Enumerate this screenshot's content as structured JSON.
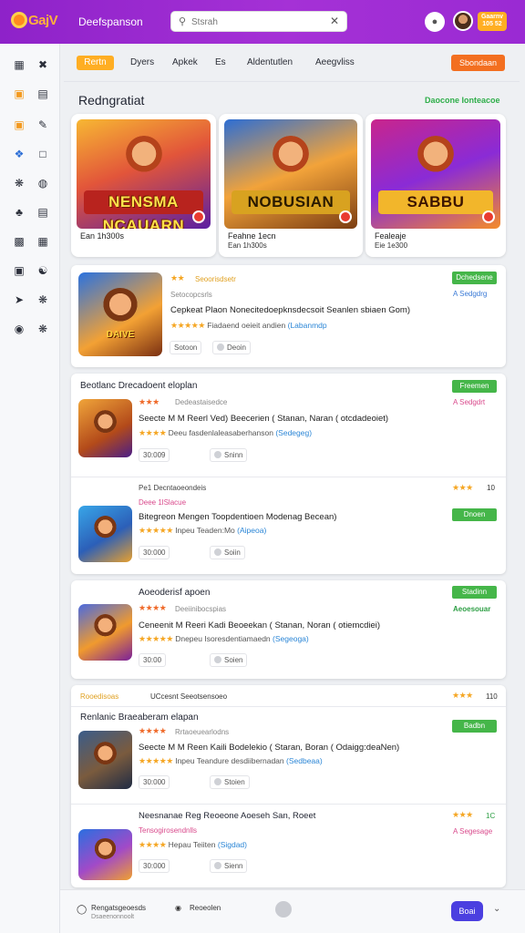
{
  "header": {
    "logo_text": "GajV",
    "app_title": "Deefspanson",
    "search_placeholder": "Stsrah",
    "coins_label": "Gaarnv 105 52"
  },
  "sidebar": {
    "icons": [
      "grid-icon",
      "tools-icon",
      "gamepad-icon",
      "card-icon",
      "tag-icon",
      "edit-icon",
      "puzzle-icon",
      "chat-icon",
      "target-icon",
      "globe-icon",
      "team-icon",
      "document-icon",
      "video-icon",
      "calendar-icon",
      "trophy-icon",
      "users-icon",
      "rocket-icon",
      "settings-icon",
      "discord-icon",
      "apps-icon"
    ]
  },
  "tabs": {
    "items": [
      "Rertn",
      "Dyers",
      "Apkek",
      "Es",
      "Aldentutlen",
      "Aeegvliss"
    ],
    "active_index": 0,
    "subscribe_label": "Sbondaan"
  },
  "featured": {
    "title": "Redngratiat",
    "see_all": "Daocone Ionteacoe",
    "items": [
      {
        "art_title": "NENSMA NCAUARN",
        "name": "Ean 1h300s",
        "sub": ""
      },
      {
        "art_title": "NOBUSIAN",
        "name": "Feahne 1ecn",
        "sub": "Ean 1h300s"
      },
      {
        "art_title": "SABBU",
        "name": "Fealeaje",
        "sub": "Eie 1e300"
      }
    ]
  },
  "card1": {
    "stars": "★★",
    "small_top": "Seoorisdsetr",
    "small_2": "Setocopcsrls",
    "headline": "Cepkeat Plaon Nonecitedoepknsdecsoit Seanlen sbiaen Gom)",
    "meta_stars": "★★★★★",
    "meta_text": "Fiadaend oeieit andien",
    "meta_link": "(Labanmdp",
    "pill1": "Sotoon",
    "pill2": "Deoin",
    "thumb_label": "DAIVE",
    "btn": "Dchedsene",
    "tag": "A Sedgdrg"
  },
  "card2": {
    "section_label": "Beotlanc Drecadoent eloplan",
    "btn_top": "Freemen",
    "tag_top": "A Sedgdrt",
    "row1": {
      "stars": "★★★",
      "small": "Dedeastaisedce",
      "headline": "Seecte M M Reerl Ved) Beecerien ( Stanan, Naran ( otcdadeoiet)",
      "meta_stars": "★★★★",
      "meta_text": "Deeu fasdenlaleasaberhanson",
      "meta_link": "(Sedegeg)",
      "pill1": "30:009",
      "pill2": "Sninn"
    },
    "row2": {
      "label": "Pe1 Decntaoeondeis",
      "small": "Deee 1lSlacue",
      "headline": "Bitegreon Mengen Toopdentioen Modenag Becean)",
      "meta_stars": "★★★★★",
      "meta_text": "Inpeu Teaden:Mo",
      "meta_link": "(Aipeoa)",
      "pill1": "30:000",
      "pill2": "Soiin",
      "stars_right": "★★★",
      "rating_right": "10",
      "btn": "Dnoen"
    }
  },
  "card3": {
    "title": "Aoeoderisf apoen",
    "small": "Deeiinibocspias",
    "headline": "Ceneenit M Reeri Kadi Beoeekan ( Stanan, Noran ( otiemcdiei)",
    "meta_stars": "★★★★★",
    "meta_text": "Dnepeu Isoresdentiamaedn",
    "meta_link": "(Segeoga)",
    "pill1": "30:00",
    "pill2": "Soien",
    "btn": "Stadinn",
    "tag": "Aeoesouar"
  },
  "card4": {
    "tag_left": "Rooedisoas",
    "header_text": "UCcesnt Seeotsensoeo",
    "stars_right": "★★★",
    "rating_right": "110",
    "row1": {
      "section": "Renlanic Braeaberam elapan",
      "stars": "★★★★",
      "small": "Rrtaoeuearlodns",
      "headline": "Seecte M M Reen Kaili Bodelekio ( Staran, Boran ( Odaigg:deaNen)",
      "meta_stars": "★★★★★",
      "meta_text": "Inpeu Teandure desdiibernadan",
      "meta_link": "(Sedbeaa)",
      "pill1": "30:000",
      "pill2": "Stoien",
      "btn": "Badbn"
    },
    "row2": {
      "title": "Neesnanae Reg Reoeone Aoeseh San, Roeet",
      "small": "Tensogirosendnlls",
      "meta_stars": "★★★★",
      "meta_text": "Hepau Teiiten",
      "meta_link": "(Sigdad)",
      "pill1": "30:000",
      "pill2": "Sienn",
      "stars_right": "★★★",
      "rating_right": "1C",
      "tag": "A Segesage"
    }
  },
  "bottombar": {
    "left_label": "Rengatsgeoesds",
    "left_sub": "Dsaeenonnoolt",
    "mid_label": "Reoeolen",
    "btn": "Boai"
  },
  "colors": {
    "header_purple": "#9a2ad3",
    "accent_orange": "#ffae23",
    "cta_orange": "#f36f20",
    "green": "#45b649",
    "link_blue": "#2b86d6"
  }
}
